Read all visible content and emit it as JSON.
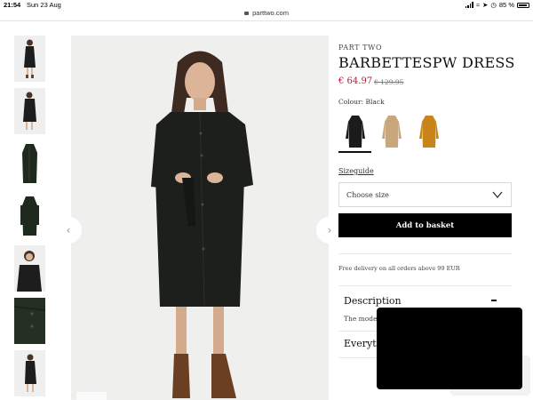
{
  "status_bar": {
    "time": "21:54",
    "date": "Sun 23 Aug",
    "battery": "85 %"
  },
  "browser": {
    "url": "parttwo.com"
  },
  "product": {
    "brand": "PART TWO",
    "name": "BARBETTESPW DRESS",
    "price": "€ 64.97",
    "original_price": "€ 129.95",
    "colour_label": "Colour: Black",
    "colours": [
      {
        "name": "black",
        "hex": "#1b1b1b"
      },
      {
        "name": "beige",
        "hex": "#c9a77c"
      },
      {
        "name": "mustard",
        "hex": "#c88419"
      }
    ],
    "sizeguide_label": "Sizeguide",
    "size_placeholder": "Choose size",
    "basket_label": "Add to basket",
    "delivery_note": "Free delivery on all orders above 99 EUR"
  },
  "accordion": {
    "description_title": "Description",
    "description_text": "The mode",
    "everything_title": "Everyth"
  },
  "gallery": {
    "thumbnail_count": 7,
    "prev_arrow": "‹",
    "next_arrow": "›"
  }
}
